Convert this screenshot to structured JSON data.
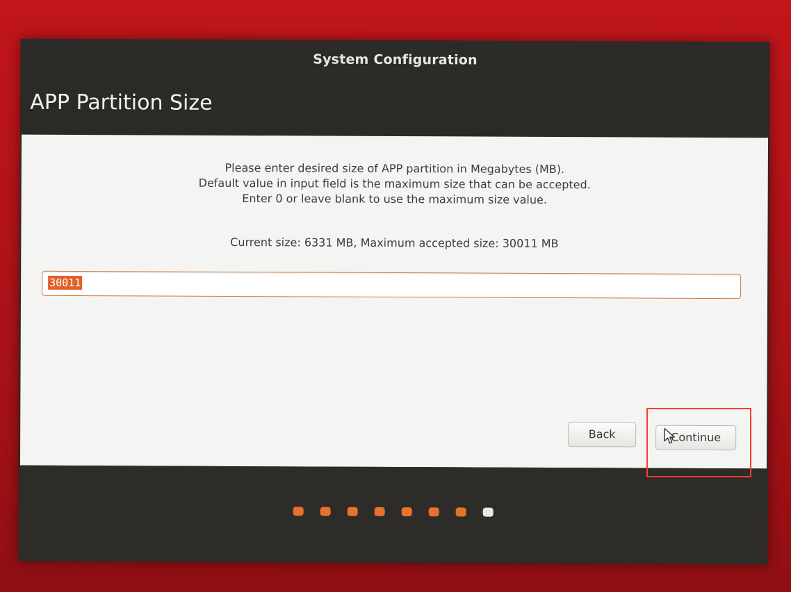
{
  "window": {
    "title": "System Configuration"
  },
  "page": {
    "title": "APP Partition Size",
    "instructions": [
      "Please enter desired size of APP partition in Megabytes (MB).",
      "Default value in input field is the maximum size that can be accepted.",
      "Enter 0 or leave blank to use the maximum size value."
    ],
    "size_info": "Current size: 6331 MB, Maximum accepted size: 30011 MB"
  },
  "input": {
    "value": "30011"
  },
  "buttons": {
    "back": "Back",
    "continue": "Continue"
  },
  "progress": {
    "total_steps": 8,
    "current_step": 8,
    "done_color": "#e8712d",
    "current_color": "#e8e8e8"
  },
  "colors": {
    "accent": "#e0622b",
    "highlight": "#ff3b30"
  }
}
